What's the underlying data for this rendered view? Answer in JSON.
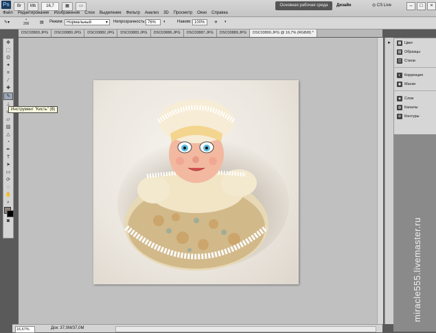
{
  "app": {
    "logo": "Ps"
  },
  "menu": [
    "Файл",
    "Редактирование",
    "Изображение",
    "Слои",
    "Выделение",
    "Фильтр",
    "Анализ",
    "3D",
    "Просмотр",
    "Окно",
    "Справка"
  ],
  "topbar": {
    "zoom": "16,7",
    "workspace": "Основная рабочая среда",
    "design": "Дизайн",
    "cslive": "CS Live"
  },
  "options": {
    "brush_size": "200",
    "mode_label": "Режим:",
    "mode_value": "Нормальный",
    "opacity_label": "Непрозрачность:",
    "opacity_value": "76%",
    "flow_label": "Нажим:",
    "flow_value": "100%"
  },
  "tabs": [
    "DSC03893.JPG",
    "DSC03880.JPG",
    "DSC03882.JPG",
    "DSC03883.JPG",
    "DSC03886.JPG",
    "DSC03887.JPG",
    "DSC03889.JPG",
    "DSC03890.JPG @ 16,7% (RGB/8) *"
  ],
  "tooltip": "Инструмент \"Кисть\" (B)",
  "panels": [
    "Цвет",
    "Образцы",
    "Стили",
    "Коррекция",
    "Маски",
    "Слои",
    "Каналы",
    "Контуры"
  ],
  "status": {
    "zoom": "16,67%",
    "doc": "Док: 37,0М/37,0М"
  },
  "watermark": "miracle555.livemaster.ru",
  "colors": {
    "foreground": "#8c8478",
    "background": "#000000"
  }
}
